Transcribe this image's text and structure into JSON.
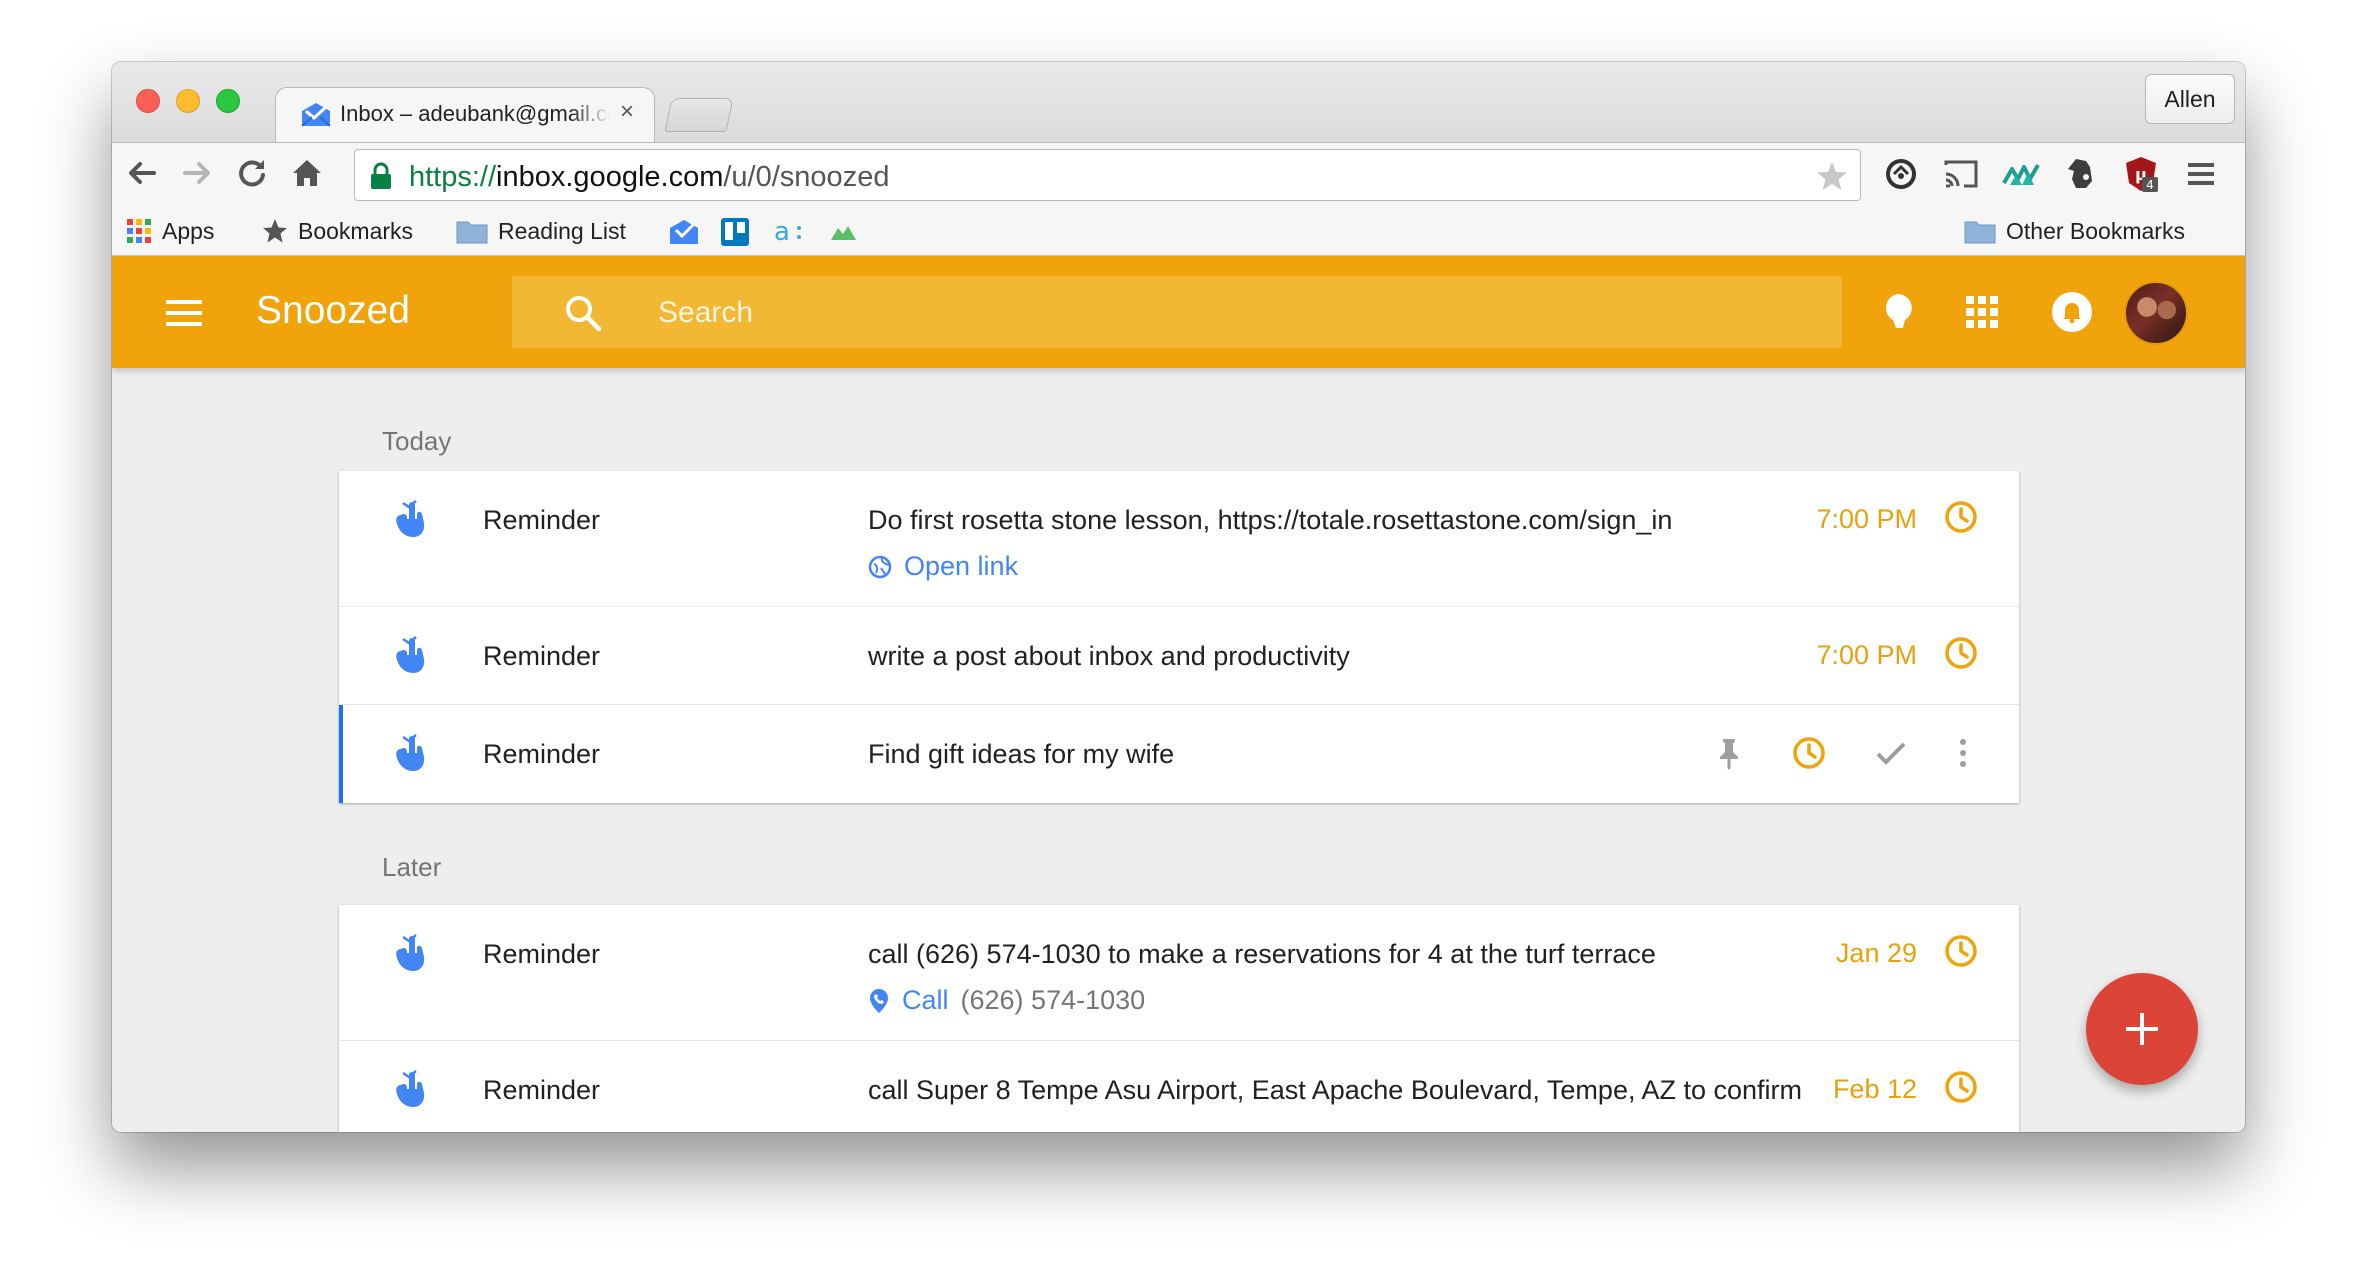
{
  "browser": {
    "tab": {
      "title": "Inbox – adeubank@gmail.com",
      "close": "×"
    },
    "profile": "Allen",
    "url": {
      "scheme": "https://",
      "host": "inbox.google.com",
      "path": "/u/0/snoozed"
    },
    "bookmarks": {
      "apps": "Apps",
      "bookmarks": "Bookmarks",
      "reading_list": "Reading List",
      "other": "Other Bookmarks"
    },
    "extension_badge": "4"
  },
  "app": {
    "title": "Snoozed",
    "search_placeholder": "Search",
    "accent_color": "#f0a30a",
    "link_color": "#4285f4",
    "fab_color": "#db4437"
  },
  "sections": {
    "today": {
      "label": "Today",
      "items": [
        {
          "type": "Reminder",
          "text": "Do first rosetta stone lesson, https://totale.rosettastone.com/sign_in",
          "action_label": "Open link",
          "action_icon": "globe-icon",
          "time": "7:00 PM"
        },
        {
          "type": "Reminder",
          "text": "write a post about inbox and productivity",
          "time": "7:00 PM"
        },
        {
          "type": "Reminder",
          "text": "Find gift ideas for my wife",
          "hover_actions": [
            "pin-icon",
            "snooze-clock-icon",
            "done-check-icon",
            "more-vert-icon"
          ]
        }
      ]
    },
    "later": {
      "label": "Later",
      "items": [
        {
          "type": "Reminder",
          "text": "call (626) 574-1030 to make a reservations for 4 at the turf terrace",
          "action_label": "Call",
          "action_extra": "(626) 574-1030",
          "action_icon": "phone-pin-icon",
          "time": "Jan 29"
        },
        {
          "type": "Reminder",
          "text": "call Super 8 Tempe Asu Airport, East Apache Boulevard, Tempe, AZ to confirm",
          "time": "Feb 12"
        }
      ]
    }
  }
}
